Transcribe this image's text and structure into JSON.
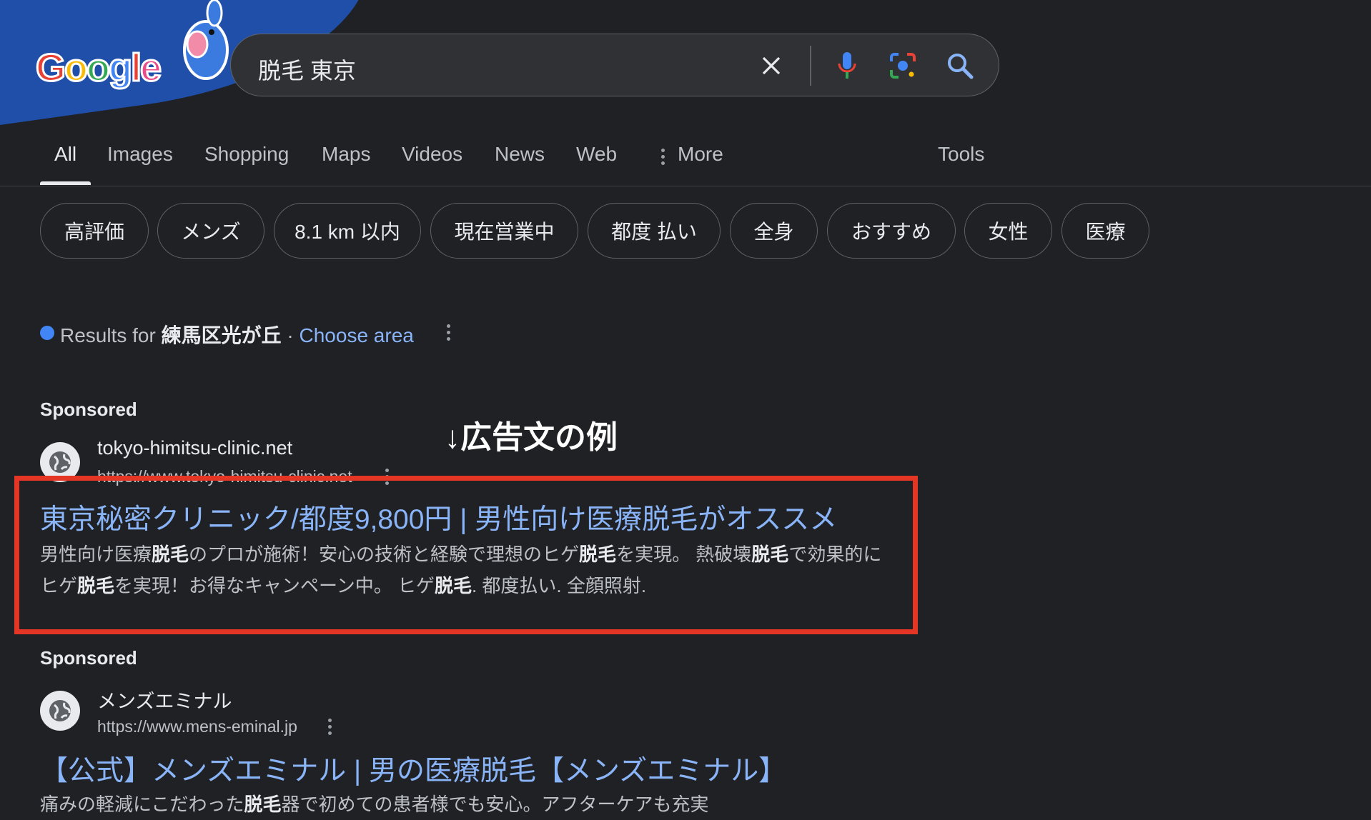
{
  "logo": {
    "text": "Google"
  },
  "search": {
    "query": "脱毛 東京",
    "icons": [
      "clear-icon",
      "mic-icon",
      "lens-icon",
      "search-icon"
    ]
  },
  "tabs": {
    "all": "All",
    "images": "Images",
    "shopping": "Shopping",
    "maps": "Maps",
    "videos": "Videos",
    "news": "News",
    "web": "Web",
    "more": "More",
    "tools": "Tools"
  },
  "chips": [
    "高評価",
    "メンズ",
    "8.1 km 以内",
    "現在営業中",
    "都度 払い",
    "全身",
    "おすすめ",
    "女性",
    "医療"
  ],
  "location": {
    "prefix": "Results for",
    "place": "練馬区光が丘",
    "separator": "·",
    "choose_area": "Choose area"
  },
  "annotation": "↓広告文の例",
  "ads": [
    {
      "sponsored": "Sponsored",
      "site_name": "tokyo-himitsu-clinic.net",
      "site_url": "https://www.tokyo-himitsu-clinic.net",
      "title": "東京秘密クリニック/都度9,800円 | 男性向け医療脱毛がオススメ",
      "desc": [
        {
          "t": "男性向け医療"
        },
        {
          "b": "脱毛"
        },
        {
          "t": "のプロが施術！安心の技術と経験で理想のヒゲ"
        },
        {
          "b": "脱毛"
        },
        {
          "t": "を実現。 熱破壊"
        },
        {
          "b": "脱毛"
        },
        {
          "t": "で効果的にヒゲ"
        },
        {
          "b": "脱毛"
        },
        {
          "t": "を実現！お得なキャンペーン中。 ヒゲ"
        },
        {
          "b": "脱毛"
        },
        {
          "t": ". 都度払い. 全顔照射."
        }
      ]
    },
    {
      "sponsored": "Sponsored",
      "site_name": "メンズエミナル",
      "site_url": "https://www.mens-eminal.jp",
      "title": "【公式】メンズエミナル | 男の医療脱毛【メンズエミナル】",
      "desc": [
        {
          "t": "痛みの軽減にこだわった"
        },
        {
          "b": "脱毛"
        },
        {
          "t": "器で初めての患者様でも安心。アフターケアも充実"
        }
      ]
    }
  ],
  "colors": {
    "background": "#202124",
    "link": "#8ab4f8",
    "highlight_box": "#e53524",
    "location_dot": "#4285f4"
  }
}
